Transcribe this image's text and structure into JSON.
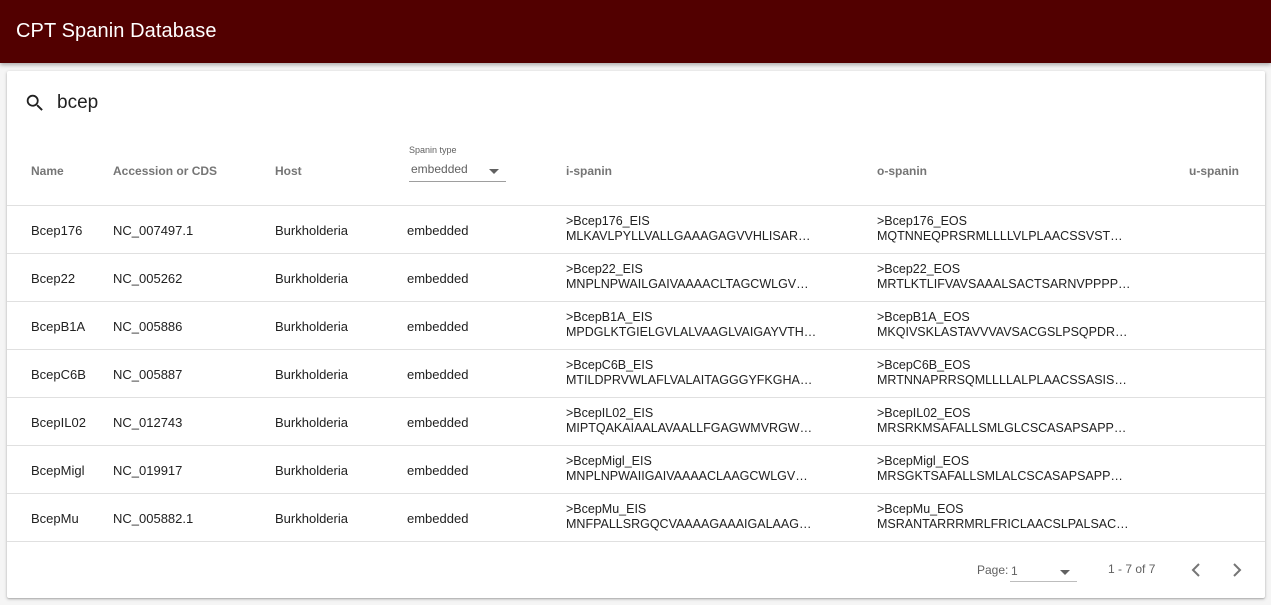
{
  "app": {
    "title": "CPT Spanin Database"
  },
  "search": {
    "value": "bcep",
    "icon": "search-icon"
  },
  "table": {
    "columns": {
      "name": "Name",
      "accession": "Accession or CDS",
      "host": "Host",
      "spanin_type_label": "Spanin type",
      "spanin_type_selected": "embedded",
      "i_spanin": "i-spanin",
      "o_spanin": "o-spanin",
      "u_spanin": "u-spanin"
    },
    "rows": [
      {
        "name": "Bcep176",
        "accession": "NC_007497.1",
        "host": "Burkholderia",
        "type": "embedded",
        "i_header": ">Bcep176_EIS",
        "i_seq": "MLKAVLPYLLVALLGAAAGAGVVHLISAR…",
        "o_header": ">Bcep176_EOS",
        "o_seq": "MQTNNEQPRSRMLLLLVLPLAACSSVST…"
      },
      {
        "name": "Bcep22",
        "accession": "NC_005262",
        "host": "Burkholderia",
        "type": "embedded",
        "i_header": ">Bcep22_EIS",
        "i_seq": "MNPLNPWAILGAIVAAAACLTAGCWLGV…",
        "o_header": ">Bcep22_EOS",
        "o_seq": "MRTLKTLIFVAVSAAALSACTSARNVPPPP…"
      },
      {
        "name": "BcepB1A",
        "accession": "NC_005886",
        "host": "Burkholderia",
        "type": "embedded",
        "i_header": ">BcepB1A_EIS",
        "i_seq": "MPDGLKTGIELGVLALVAAGLVAIGAYVTH…",
        "o_header": ">BcepB1A_EOS",
        "o_seq": "MKQIVSKLASTAVVVAVSACGSLPSQPDR…"
      },
      {
        "name": "BcepC6B",
        "accession": "NC_005887",
        "host": "Burkholderia",
        "type": "embedded",
        "i_header": ">BcepC6B_EIS",
        "i_seq": "MTILDPRVWLAFLVALAITAGGGYFKGHA…",
        "o_header": ">BcepC6B_EOS",
        "o_seq": "MRTNNAPRRSQMLLLLALPLAACSSASIS…"
      },
      {
        "name": "BcepIL02",
        "accession": "NC_012743",
        "host": "Burkholderia",
        "type": "embedded",
        "i_header": ">BcepIL02_EIS",
        "i_seq": "MIPTQAKAIAALAVAALLFGAGWMVRGW…",
        "o_header": ">BcepIL02_EOS",
        "o_seq": "MRSRKMSAFALLSMLGLCSCASAPSAPP…"
      },
      {
        "name": "BcepMigl",
        "accession": "NC_019917",
        "host": "Burkholderia",
        "type": "embedded",
        "i_header": ">BcepMigl_EIS",
        "i_seq": "MNPLNPWAIIGAIVAAAACLAAGCWLGV…",
        "o_header": ">BcepMigl_EOS",
        "o_seq": "MRSGKTSAFALLSMLALCSCASAPSAPP…"
      },
      {
        "name": "BcepMu",
        "accession": "NC_005882.1",
        "host": "Burkholderia",
        "type": "embedded",
        "i_header": ">BcepMu_EIS",
        "i_seq": "MNFPALLSRGQCVAAAAGAAAIGALAAG…",
        "o_header": ">BcepMu_EOS",
        "o_seq": "MSRANTARRRMRLFRICLAACSLPALSAC…"
      }
    ]
  },
  "pagination": {
    "page_label": "Page:",
    "page_value": "1",
    "range": "1 - 7 of 7",
    "prev_icon": "chevron-left-icon",
    "next_icon": "chevron-right-icon"
  },
  "colors": {
    "appbar": "#520000",
    "background": "#f5f5f5"
  }
}
